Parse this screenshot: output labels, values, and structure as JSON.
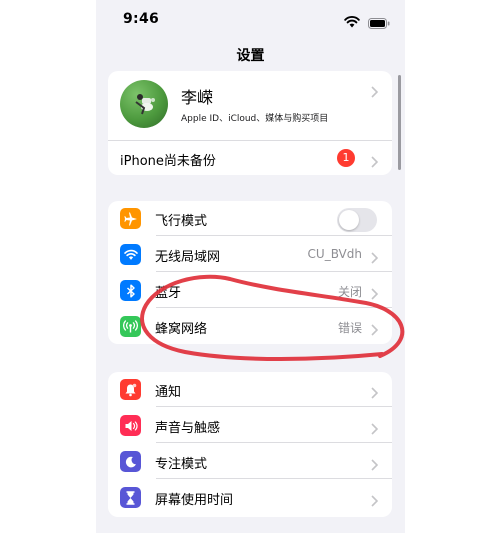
{
  "status_bar": {
    "time": "9:46"
  },
  "nav": {
    "title": "设置"
  },
  "profile": {
    "name": "李嵘",
    "subtitle": "Apple ID、iCloud、媒体与购买项目",
    "backup_label": "iPhone尚未备份",
    "backup_badge": "1"
  },
  "network_group": {
    "items": [
      {
        "label": "飞行模式",
        "icon": "airplane-icon",
        "color": "#ff9500",
        "toggle": "off"
      },
      {
        "label": "无线局域网",
        "value": "CU_BVdh",
        "icon": "wifi-icon",
        "color": "#007aff"
      },
      {
        "label": "蓝牙",
        "value": "关闭",
        "icon": "bluetooth-icon",
        "color": "#007aff"
      },
      {
        "label": "蜂窝网络",
        "value": "错误",
        "icon": "cellular-icon",
        "color": "#34c759"
      }
    ]
  },
  "notify_group": {
    "items": [
      {
        "label": "通知",
        "icon": "bell-icon",
        "color": "#ff3b30"
      },
      {
        "label": "声音与触感",
        "icon": "speaker-icon",
        "color": "#ff2d55"
      },
      {
        "label": "专注模式",
        "icon": "moon-icon",
        "color": "#5856d6"
      },
      {
        "label": "屏幕使用时间",
        "icon": "hourglass-icon",
        "color": "#5856d6"
      }
    ]
  },
  "annotation": {
    "color": "#e0303a"
  }
}
